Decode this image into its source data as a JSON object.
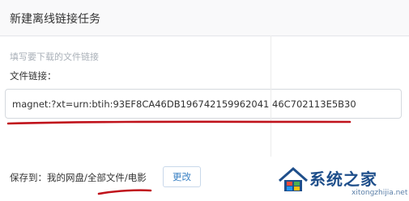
{
  "dialog": {
    "title": "新建离线链接任务",
    "hint": "填写要下载的文件链接",
    "field_label": "文件链接：",
    "url_value": "magnet:?xt=urn:btih:93EF8CA46DB196742159962041 46C702113E5B30",
    "save_to_label": "保存到：",
    "save_path": "我的网盘/全部文件/电影",
    "change_button": "更改"
  },
  "watermark": {
    "brand": "系统之家",
    "url": "xitongzhijia.net"
  },
  "colors": {
    "accent": "#3b82c4",
    "annotation": "#c0121b"
  }
}
